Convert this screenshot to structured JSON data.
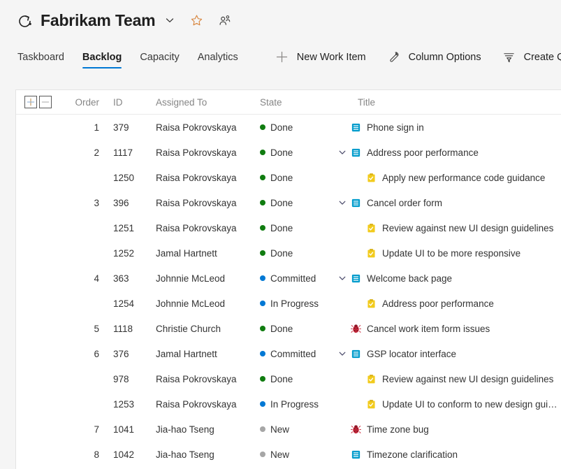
{
  "header": {
    "team_icon": "sprint-loop-icon",
    "title": "Fabrikam Team",
    "chevron_icon": "chevron-down-icon",
    "favorite_icon": "star-icon",
    "team_members_icon": "people-icon",
    "favorite_color": "#d7833a"
  },
  "tabs": [
    {
      "label": "Taskboard",
      "active": false
    },
    {
      "label": "Backlog",
      "active": true
    },
    {
      "label": "Capacity",
      "active": false
    },
    {
      "label": "Analytics",
      "active": false
    }
  ],
  "toolbar": [
    {
      "label": "New Work Item",
      "icon": "plus-icon"
    },
    {
      "label": "Column Options",
      "icon": "wrench-icon"
    },
    {
      "label": "Create Query",
      "icon": "filter-icon"
    }
  ],
  "grid": {
    "expand_all_icon": "plus-box-icon",
    "collapse_all_icon": "minus-box-icon",
    "columns": [
      "Order",
      "ID",
      "Assigned To",
      "State",
      "Title"
    ],
    "state_colors": {
      "Done": "#107c10",
      "Committed": "#0078d4",
      "In Progress": "#0078d4",
      "New": "#a6a6a6"
    },
    "rows": [
      {
        "order": "1",
        "id": "379",
        "assigned": "Raisa Pokrovskaya",
        "state": "Done",
        "title": "Phone sign in",
        "type": "story",
        "indent": 0,
        "chevron": false
      },
      {
        "order": "2",
        "id": "1117",
        "assigned": "Raisa Pokrovskaya",
        "state": "Done",
        "title": "Address poor performance",
        "type": "story",
        "indent": 0,
        "chevron": true
      },
      {
        "order": "",
        "id": "1250",
        "assigned": "Raisa Pokrovskaya",
        "state": "Done",
        "title": "Apply new performance code guidance",
        "type": "task",
        "indent": 1,
        "chevron": false
      },
      {
        "order": "3",
        "id": "396",
        "assigned": "Raisa Pokrovskaya",
        "state": "Done",
        "title": "Cancel order form",
        "type": "story",
        "indent": 0,
        "chevron": true
      },
      {
        "order": "",
        "id": "1251",
        "assigned": "Raisa Pokrovskaya",
        "state": "Done",
        "title": "Review against new UI design guidelines",
        "type": "task",
        "indent": 1,
        "chevron": false
      },
      {
        "order": "",
        "id": "1252",
        "assigned": "Jamal Hartnett",
        "state": "Done",
        "title": "Update UI to be more responsive",
        "type": "task",
        "indent": 1,
        "chevron": false
      },
      {
        "order": "4",
        "id": "363",
        "assigned": "Johnnie McLeod",
        "state": "Committed",
        "title": "Welcome back page",
        "type": "story",
        "indent": 0,
        "chevron": true
      },
      {
        "order": "",
        "id": "1254",
        "assigned": "Johnnie McLeod",
        "state": "In Progress",
        "title": "Address poor performance",
        "type": "task",
        "indent": 1,
        "chevron": false
      },
      {
        "order": "5",
        "id": "1118",
        "assigned": "Christie Church",
        "state": "Done",
        "title": "Cancel work item form issues",
        "type": "bug",
        "indent": 0,
        "chevron": false
      },
      {
        "order": "6",
        "id": "376",
        "assigned": "Jamal Hartnett",
        "state": "Committed",
        "title": "GSP locator interface",
        "type": "story",
        "indent": 0,
        "chevron": true
      },
      {
        "order": "",
        "id": "978",
        "assigned": "Raisa Pokrovskaya",
        "state": "Done",
        "title": "Review against new UI design guidelines",
        "type": "task",
        "indent": 1,
        "chevron": false
      },
      {
        "order": "",
        "id": "1253",
        "assigned": "Raisa Pokrovskaya",
        "state": "In Progress",
        "title": "Update UI to conform to new design guidelines",
        "type": "task",
        "indent": 1,
        "chevron": false
      },
      {
        "order": "7",
        "id": "1041",
        "assigned": "Jia-hao Tseng",
        "state": "New",
        "title": "Time zone bug",
        "type": "bug",
        "indent": 0,
        "chevron": false
      },
      {
        "order": "8",
        "id": "1042",
        "assigned": "Jia-hao Tseng",
        "state": "New",
        "title": "Timezone clarification",
        "type": "story",
        "indent": 0,
        "chevron": false
      }
    ]
  }
}
